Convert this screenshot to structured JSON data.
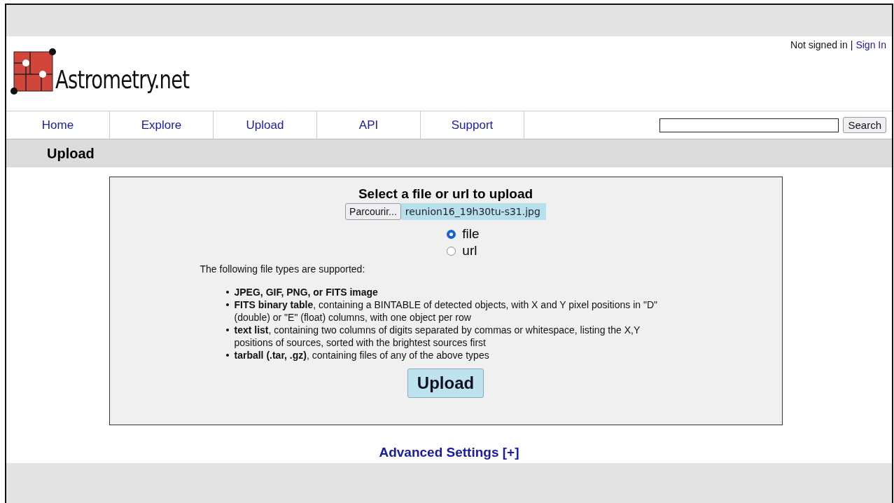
{
  "header": {
    "site_name": "Astrometry.net",
    "auth_status": "Not signed in",
    "auth_separator": "|",
    "sign_in_link": "Sign In"
  },
  "nav": [
    {
      "label": "Home"
    },
    {
      "label": "Explore"
    },
    {
      "label": "Upload"
    },
    {
      "label": "API"
    },
    {
      "label": "Support"
    }
  ],
  "search": {
    "button": "Search"
  },
  "page_title": "Upload",
  "upload_form": {
    "heading": "Select a file or url to upload",
    "browse_button": "Parcourir...",
    "file_name": "reunion16_19h30tu-s31.jpg",
    "source_options": [
      {
        "label": "file",
        "selected": true
      },
      {
        "label": "url",
        "selected": false
      }
    ],
    "supported_intro": "The following file types are supported:",
    "supported_types": [
      "**JPEG, GIF, PNG, or FITS image**",
      "**FITS binary table**, containing a BINTABLE of detected objects, with X and Y pixel positions in \"D\" (double) or \"E\" (float) columns, with one object per row",
      "**text list**, containing two columns of digits separated by commas or whitespace, listing the X,Y positions of sources, sorted with the brightest sources first",
      "**tarball (.tar, .gz)**, containing files of any of the above types"
    ],
    "submit_button": "Upload"
  },
  "advanced_link": "Advanced Settings [+]"
}
